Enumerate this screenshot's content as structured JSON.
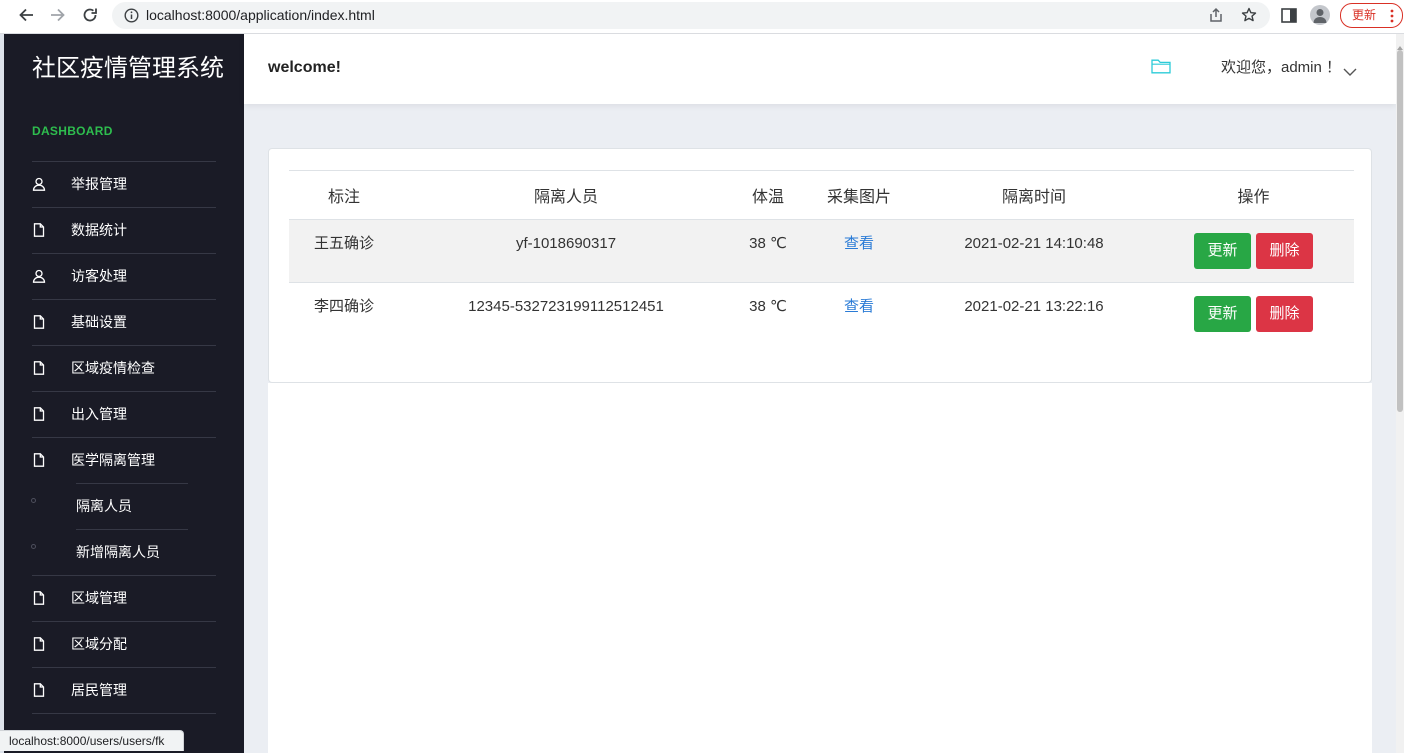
{
  "browser": {
    "url": "localhost:8000/application/index.html",
    "update_label": "更新",
    "status_url": "localhost:8000/users/users/fk"
  },
  "sidebar": {
    "title": "社区疫情管理系统",
    "section_label": "DASHBOARD",
    "items": [
      {
        "label": "举报管理",
        "icon": "user-icon"
      },
      {
        "label": "数据统计",
        "icon": "file-icon"
      },
      {
        "label": "访客处理",
        "icon": "user-icon"
      },
      {
        "label": "基础设置",
        "icon": "file-icon"
      },
      {
        "label": "区域疫情检查",
        "icon": "file-icon"
      },
      {
        "label": "出入管理",
        "icon": "file-icon"
      },
      {
        "label": "医学隔离管理",
        "icon": "file-icon",
        "children": [
          {
            "label": "隔离人员"
          },
          {
            "label": "新增隔离人员"
          }
        ]
      },
      {
        "label": "区域管理",
        "icon": "file-icon"
      },
      {
        "label": "区域分配",
        "icon": "file-icon"
      },
      {
        "label": "居民管理",
        "icon": "file-icon"
      }
    ]
  },
  "header": {
    "welcome": "welcome!",
    "greeting": "欢迎您，admin ！"
  },
  "table": {
    "columns": [
      "标注",
      "隔离人员",
      "体温",
      "采集图片",
      "隔离时间",
      "操作"
    ],
    "rows": [
      {
        "note": "王五确诊",
        "person": "yf-1018690317",
        "temperature": "38 ℃",
        "image": "查看",
        "time": "2021-02-21 14:10:48",
        "update": "更新",
        "delete": "删除"
      },
      {
        "note": "李四确诊",
        "person": "12345-532723199112512451",
        "temperature": "38 ℃",
        "image": "查看",
        "time": "2021-02-21 13:22:16",
        "update": "更新",
        "delete": "删除"
      }
    ]
  },
  "colors": {
    "sidebar_bg": "#1a1b26",
    "section_green": "#2ebd4e",
    "update_green": "#28a745",
    "delete_red": "#dc3545",
    "link_blue": "#2a7bd6",
    "folder_cyan": "#2ccbd8",
    "page_bg": "#ebeef3"
  }
}
